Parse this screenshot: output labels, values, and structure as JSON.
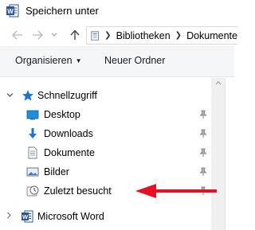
{
  "window": {
    "title": "Speichern unter"
  },
  "address_bar": {
    "segments": [
      "Bibliotheken",
      "Dokumente"
    ]
  },
  "toolbar": {
    "organize_label": "Organisieren",
    "new_folder_label": "Neuer Ordner"
  },
  "nav_tree": {
    "quick_access": {
      "label": "Schnellzugriff",
      "items": [
        {
          "label": "Desktop",
          "icon": "desktop-icon",
          "pinned": true
        },
        {
          "label": "Downloads",
          "icon": "downloads-icon",
          "pinned": true
        },
        {
          "label": "Dokumente",
          "icon": "documents-icon",
          "pinned": true
        },
        {
          "label": "Bilder",
          "icon": "pictures-icon",
          "pinned": true
        },
        {
          "label": "Zuletzt besucht",
          "icon": "recent-places-icon",
          "pinned": true
        }
      ]
    },
    "word_item": {
      "label": "Microsoft Word"
    }
  },
  "colors": {
    "accent_blue": "#1e73d2",
    "word_blue": "#2b579a",
    "annotation_red": "#e81123",
    "toolbar_bg": "#f5f6f7"
  }
}
